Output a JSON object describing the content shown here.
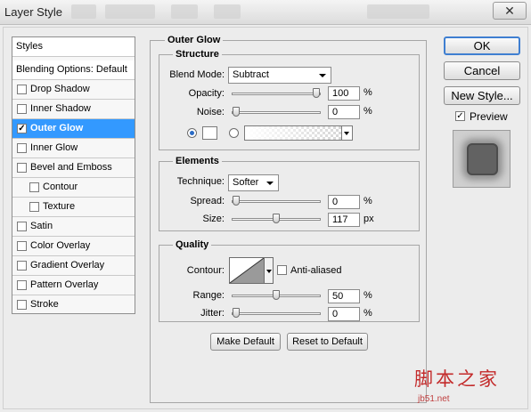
{
  "window": {
    "title": "Layer Style",
    "close_label": "✕"
  },
  "styles_panel": {
    "header": "Styles",
    "blending_options": "Blending Options: Default",
    "items": [
      {
        "label": "Drop Shadow",
        "checked": false
      },
      {
        "label": "Inner Shadow",
        "checked": false
      },
      {
        "label": "Outer Glow",
        "checked": true,
        "selected": true
      },
      {
        "label": "Inner Glow",
        "checked": false
      },
      {
        "label": "Bevel and Emboss",
        "checked": false
      },
      {
        "label": "Contour",
        "checked": false,
        "sub": true
      },
      {
        "label": "Texture",
        "checked": false,
        "sub": true
      },
      {
        "label": "Satin",
        "checked": false
      },
      {
        "label": "Color Overlay",
        "checked": false
      },
      {
        "label": "Gradient Overlay",
        "checked": false
      },
      {
        "label": "Pattern Overlay",
        "checked": false
      },
      {
        "label": "Stroke",
        "checked": false
      }
    ]
  },
  "outer_glow": {
    "title": "Outer Glow",
    "structure": {
      "title": "Structure",
      "blend_mode_label": "Blend Mode:",
      "blend_mode_value": "Subtract",
      "opacity_label": "Opacity:",
      "opacity_value": "100",
      "opacity_fraction": 1.0,
      "noise_label": "Noise:",
      "noise_value": "0",
      "noise_fraction": 0.0,
      "percent": "%",
      "color_mode": "solid",
      "glow_color": "#ffffff"
    },
    "elements": {
      "title": "Elements",
      "technique_label": "Technique:",
      "technique_value": "Softer",
      "spread_label": "Spread:",
      "spread_value": "0",
      "spread_fraction": 0.0,
      "size_label": "Size:",
      "size_value": "117",
      "size_fraction": 0.5,
      "percent": "%",
      "px": "px"
    },
    "quality": {
      "title": "Quality",
      "contour_label": "Contour:",
      "anti_aliased_label": "Anti-aliased",
      "anti_aliased": false,
      "range_label": "Range:",
      "range_value": "50",
      "range_fraction": 0.5,
      "jitter_label": "Jitter:",
      "jitter_value": "0",
      "jitter_fraction": 0.0,
      "percent": "%"
    },
    "make_default": "Make Default",
    "reset_to_default": "Reset to Default"
  },
  "buttons": {
    "ok": "OK",
    "cancel": "Cancel",
    "new_style": "New Style...",
    "preview_label": "Preview",
    "preview_checked": true
  },
  "watermark": {
    "main": "脚本之家",
    "sub": "jb51.net"
  }
}
